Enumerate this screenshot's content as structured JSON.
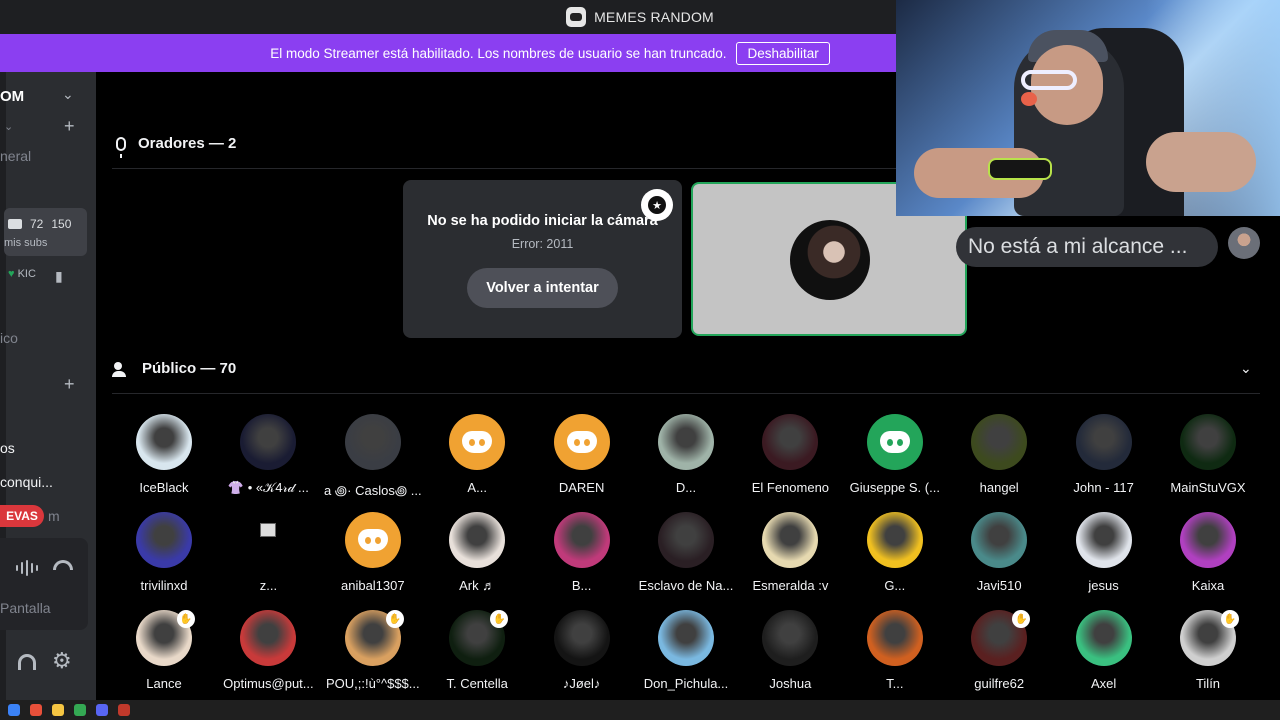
{
  "titlebar": {
    "server_name": "MEMES RANDOM"
  },
  "banner": {
    "message": "El modo Streamer está habilitado. Los nombres de usuario se han truncado.",
    "disable_label": "Deshabilitar"
  },
  "sidebar": {
    "server_fragment": "OM",
    "channel_fragments": [
      "neral",
      "ico",
      "os",
      "conqui...",
      "m"
    ],
    "live_count": "72",
    "live_limit": "150",
    "live_sub": "mis subs",
    "activity_fragment": "KIC",
    "new_badge": "EVAS",
    "screen_label": "Pantalla"
  },
  "stage": {
    "speakers_header": "Oradores — 2",
    "audience_header": "Público — 70",
    "camera_error_title": "No se ha podido iniciar la cámara",
    "camera_error_code": "Error: 2011",
    "retry_label": "Volver a intentar"
  },
  "caption": {
    "text": "No está a mi alcance ..."
  },
  "audience": [
    {
      "name": "IceBlack",
      "color": "#d8e6ee",
      "kind": "photo"
    },
    {
      "name": "👚 • «𝒦4𝓇𝒹 ...",
      "color": "#1a1c33",
      "kind": "photo"
    },
    {
      "name": "a ꩜· Caslos꩜ ...",
      "color": "#3a3d44",
      "kind": "photo"
    },
    {
      "name": "A...",
      "color": "#f0a232",
      "kind": "discord"
    },
    {
      "name": "DAREN",
      "color": "#f0a232",
      "kind": "discord"
    },
    {
      "name": "D...",
      "color": "#9fb3a8",
      "kind": "photo"
    },
    {
      "name": "El Fenomeno",
      "color": "#3b1a22",
      "kind": "photo"
    },
    {
      "name": "Giuseppe S. (...",
      "color": "#23a55a",
      "kind": "discord-green"
    },
    {
      "name": "hangel",
      "color": "#3d4a1e",
      "kind": "photo"
    },
    {
      "name": "John - 117",
      "color": "#232a3a",
      "kind": "photo"
    },
    {
      "name": "MainStuVGX",
      "color": "#0f2a12",
      "kind": "photo"
    },
    {
      "name": "trivilinxd",
      "color": "#3a3aa8",
      "kind": "photo"
    },
    {
      "name": "z...",
      "color": "#000000",
      "kind": "broken"
    },
    {
      "name": "anibal1307",
      "color": "#f0a232",
      "kind": "discord"
    },
    {
      "name": "Ark ♬",
      "color": "#e8e0da",
      "kind": "photo"
    },
    {
      "name": "B...",
      "color": "#c03a7a",
      "kind": "photo"
    },
    {
      "name": "Esclavo de Na...",
      "color": "#2a1f24",
      "kind": "photo"
    },
    {
      "name": "Esmeralda :v",
      "color": "#e6d9b0",
      "kind": "photo"
    },
    {
      "name": "G...",
      "color": "#f0c020",
      "kind": "photo"
    },
    {
      "name": "Javi510",
      "color": "#4a8a8a",
      "kind": "photo"
    },
    {
      "name": "jesus",
      "color": "#dfe3ea",
      "kind": "photo"
    },
    {
      "name": "Kaixa",
      "color": "#b040c0",
      "kind": "photo"
    },
    {
      "name": "Lance",
      "color": "#e8d8c8",
      "kind": "photo",
      "hand": true
    },
    {
      "name": "Optimus@put...",
      "color": "#c83a3a",
      "kind": "photo"
    },
    {
      "name": "POU,;:!ù°^$$$...",
      "color": "#d9a060",
      "kind": "photo",
      "hand": true
    },
    {
      "name": "T. Centella",
      "color": "#0f1f10",
      "kind": "photo",
      "hand": true
    },
    {
      "name": "♪Jøel♪",
      "color": "#141414",
      "kind": "photo"
    },
    {
      "name": "Don_Pichula...",
      "color": "#7ab8e0",
      "kind": "photo"
    },
    {
      "name": "Joshua",
      "color": "#1e1e1e",
      "kind": "photo"
    },
    {
      "name": "T...",
      "color": "#d06020",
      "kind": "photo"
    },
    {
      "name": "guilfre62",
      "color": "#5a2020",
      "kind": "photo",
      "hand": true
    },
    {
      "name": "Axel",
      "color": "#3ac080",
      "kind": "photo"
    },
    {
      "name": "Tilín",
      "color": "#cfcfcf",
      "kind": "photo",
      "hand": true
    }
  ]
}
